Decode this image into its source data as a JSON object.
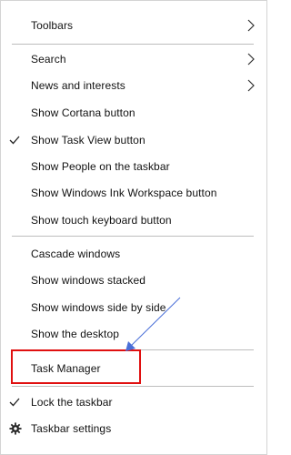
{
  "menu": {
    "items": [
      {
        "label": "Toolbars",
        "has_submenu": true
      },
      {
        "label": "Search",
        "has_submenu": true
      },
      {
        "label": "News and interests",
        "has_submenu": true
      },
      {
        "label": "Show Cortana button"
      },
      {
        "label": "Show Task View button",
        "checked": true
      },
      {
        "label": "Show People on the taskbar"
      },
      {
        "label": "Show Windows Ink Workspace button"
      },
      {
        "label": "Show touch keyboard button"
      },
      {
        "label": "Cascade windows"
      },
      {
        "label": "Show windows stacked"
      },
      {
        "label": "Show windows side by side"
      },
      {
        "label": "Show the desktop"
      },
      {
        "label": "Task Manager",
        "highlighted": true
      },
      {
        "label": "Lock the taskbar",
        "checked": true
      },
      {
        "label": "Taskbar settings",
        "icon": "gear-icon"
      }
    ]
  },
  "annotation": {
    "highlight_color": "#e01010",
    "arrow_color": "#4a6fd8"
  },
  "icons": {
    "submenu": "chevron-right-icon",
    "check": "checkmark-icon",
    "settings": "gear-icon"
  }
}
